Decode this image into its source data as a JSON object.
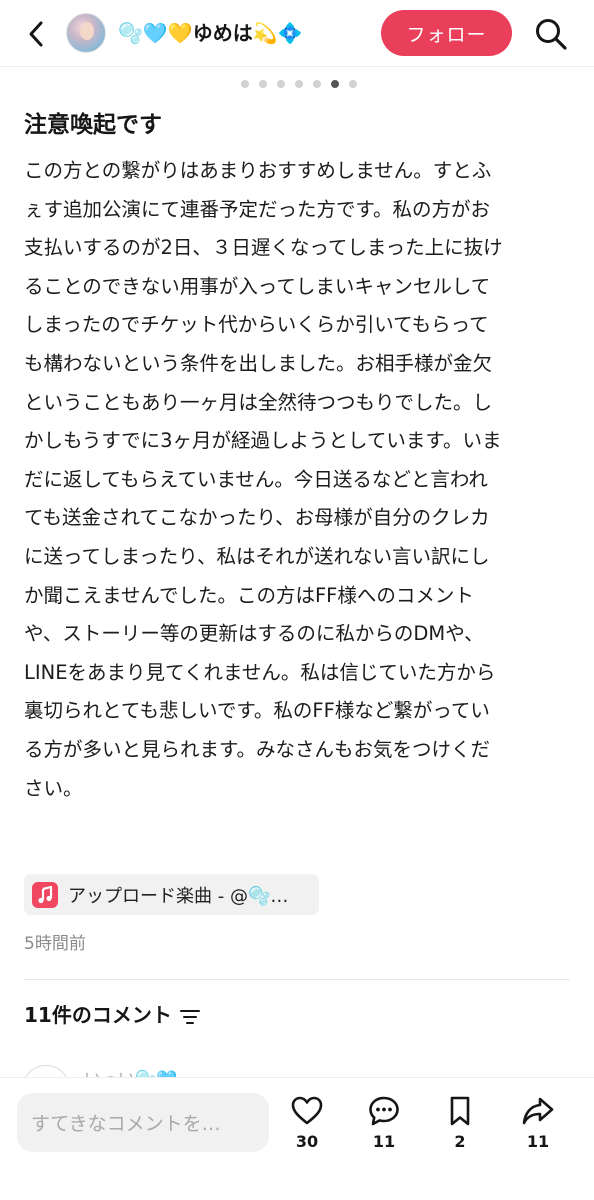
{
  "header": {
    "username": "🫧🩵💛ゆめは💫💠",
    "follow_label": "フォロー"
  },
  "carousel": {
    "total": 7,
    "active_index": 5
  },
  "post": {
    "title": "注意喚起です",
    "body_lines": [
      "この方との繋がりはあまりおすすめしません。すとふ",
      "ぇす追加公演にて連番予定だった方です。私の方がお",
      "支払いするのが2日、３日遅くなってしまった上に抜け",
      "ることのできない用事が入ってしまいキャンセルして",
      "しまったのでチケット代からいくらか引いてもらって",
      "も構わないという条件を出しました。お相手様が金欠",
      "ということもあり一ヶ月は全然待つつもりでした。し",
      "かしもうすでに3ヶ月が経過しようとしています。いま",
      "だに返してもらえていません。今日送るなどと言われ",
      "ても送金されてこなかったり、お母様が自分のクレカ",
      "に送ってしまったり、私はそれが送れない言い訳にし",
      "か聞こえませんでした。この方はFF様へのコメント",
      "や、ストーリー等の更新はするのに私からのDMや、",
      "LINEをあまり見てくれません。私は信じていた方から",
      "裏切られとても悲しいです。私のFF様など繋がってい",
      "る方が多いと見られます。みなさんもお気をつけくだ",
      "さい。"
    ],
    "music_label": "アップロード楽曲 - @🫧…",
    "time_ago": "5時間前"
  },
  "comments": {
    "header": "11件のコメント",
    "peek_name": "いっい🫧🩵"
  },
  "bottom_bar": {
    "comment_placeholder": "すてきなコメントを…",
    "likes": "30",
    "comments": "11",
    "saves": "2",
    "shares": "11"
  },
  "colors": {
    "accent": "#ea3f5a",
    "music_icon": "#f0465f",
    "active_dot": "#555555",
    "inactive_dot": "#d2d2d2"
  },
  "icons": {
    "back": "chevron-left-icon",
    "search": "search-icon",
    "music": "music-note-icon",
    "filter": "sort-filter-icon",
    "like": "heart-icon",
    "comment": "comment-bubble-icon",
    "save": "bookmark-icon",
    "share": "share-arrow-icon"
  }
}
